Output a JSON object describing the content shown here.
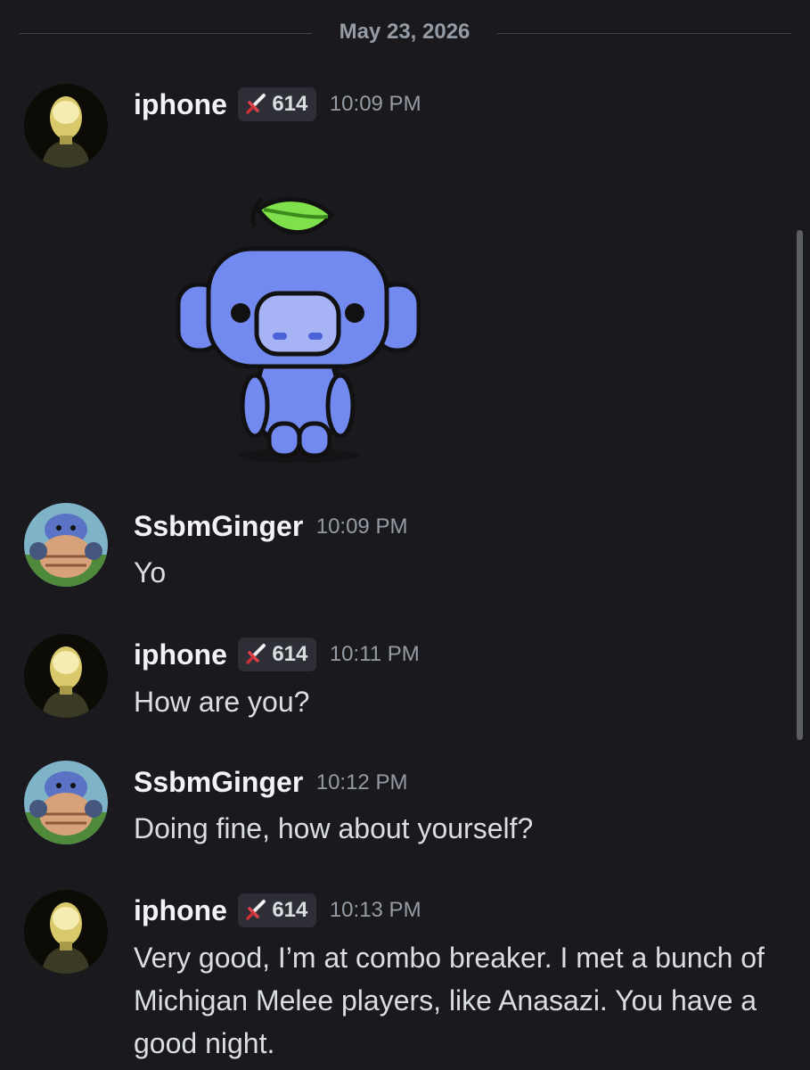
{
  "date_divider": "May 23, 2026",
  "sticker": {
    "icon": "wumpus-leaf-sticker"
  },
  "tag_icon": "sword-icon",
  "messages": [
    {
      "username": "iphone",
      "tag": "614",
      "timestamp": "10:09 PM",
      "text": ""
    },
    {
      "username": "SsbmGinger",
      "timestamp": "10:09 PM",
      "text": "Yo"
    },
    {
      "username": "iphone",
      "tag": "614",
      "timestamp": "10:11 PM",
      "text": "How are you?"
    },
    {
      "username": "SsbmGinger",
      "timestamp": "10:12 PM",
      "text": "Doing fine, how about yourself?"
    },
    {
      "username": "iphone",
      "tag": "614",
      "timestamp": "10:13 PM",
      "text": "Very good, I’m at combo breaker. I met a bunch of Michigan Melee players, like Anasazi. You have a good night."
    }
  ],
  "colors": {
    "background": "#1a1a1e",
    "username": "#f2f3f5",
    "timestamp": "#949ba4",
    "message_text": "#dbdee1",
    "tag_background": "#2e2f36",
    "wumpus_blue": "#7289f0",
    "leaf_green": "#7ee04a"
  }
}
